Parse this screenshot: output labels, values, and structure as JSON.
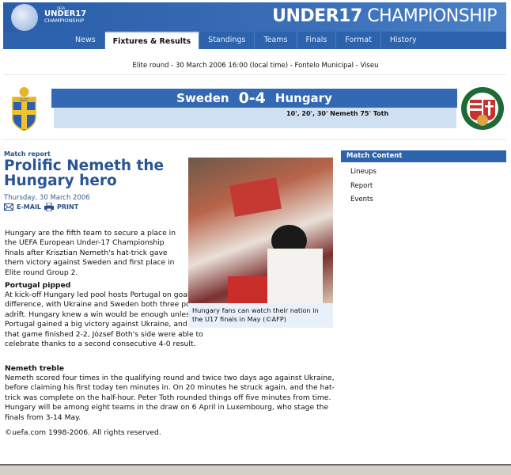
{
  "header": {
    "logo_top": "UEFA",
    "logo_main": "UNDER17",
    "logo_sub": "CHAMPIONSHIP",
    "title_bold": "UNDER17",
    "title_light": "CHAMPIONSHIP"
  },
  "nav": {
    "tabs": [
      {
        "label": "News"
      },
      {
        "label": "Fixtures & Results",
        "active": true
      },
      {
        "label": "Standings"
      },
      {
        "label": "Teams"
      },
      {
        "label": "Finals"
      },
      {
        "label": "Format"
      },
      {
        "label": "History"
      }
    ]
  },
  "match": {
    "info": "Elite round - 30 March 2006 16:00 (local time) - Fontelo Municipal - Viseu",
    "home": "Sweden",
    "score": "0-4",
    "away": "Hungary",
    "scorers": "10', 20', 30' Nemeth 75' Toth",
    "home_badge": "SvFF",
    "colors": {
      "bar": "#3369b4",
      "strip": "#cfe0f3"
    }
  },
  "article": {
    "kicker": "Match report",
    "headline": "Prolific Nemeth the Hungary hero",
    "date": "Thursday, 30 March 2006",
    "email": "E-MAIL",
    "print": "PRINT",
    "intro": "Hungary are the fifth team to secure a place in the UEFA European Under-17 Championship finals after Krisztian Nemeth's hat-trick gave them victory against Sweden and first place in Elite round Group 2.",
    "sections": [
      {
        "heading": "Portugal pipped",
        "text": "At kick-off Hungary led pool hosts Portugal on goal difference, with Ukraine and Sweden both three points adrift. Hungary knew a win would be enough unless Portugal gained a big victory against Ukraine, and as that game finished 2-2, József Both's side were able to celebrate thanks to a second consecutive 4-0 result."
      },
      {
        "heading": "Nemeth treble",
        "text": "Nemeth scored four times in the qualifying round and twice two days ago against Ukraine, before claiming his first today ten minutes in. On 20 minutes he struck again, and the hat-trick was complete on the half-hour. Peter Toth rounded things off five minutes from time. Hungary will be among eight teams in the draw on 6 April in Luxembourg, who stage the finals from 3-14 May."
      }
    ],
    "caption": "Hungary fans can watch their nation in the U17 finals in May (©AFP)",
    "copyright": "©uefa.com 1998-2006. All rights reserved."
  },
  "sidebar": {
    "title": "Match Content",
    "items": [
      {
        "label": "Lineups"
      },
      {
        "label": "Report"
      },
      {
        "label": "Events"
      }
    ]
  }
}
